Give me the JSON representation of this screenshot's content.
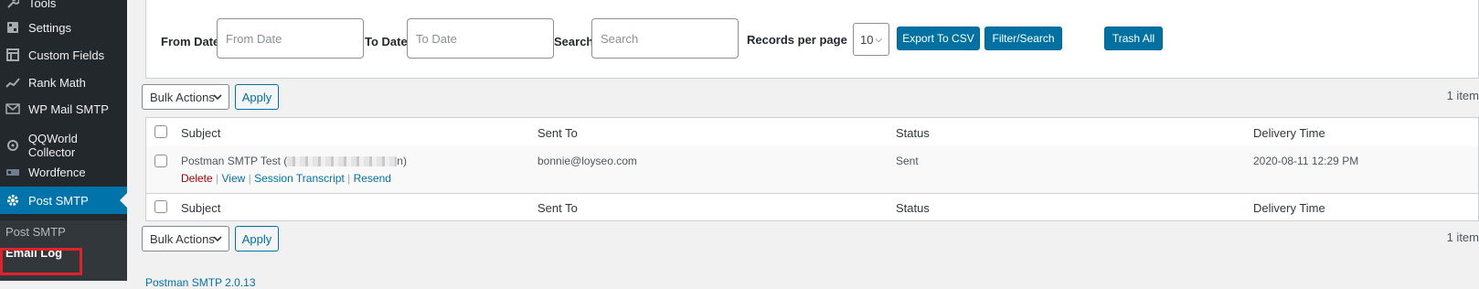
{
  "sidebar": {
    "menu": [
      {
        "label": "Tools",
        "icon": "wrench-icon"
      },
      {
        "label": "Settings",
        "icon": "settings-icon"
      },
      {
        "label": "Custom Fields",
        "icon": "custom-fields-icon"
      },
      {
        "label": "Rank Math",
        "icon": "rank-math-icon"
      },
      {
        "label": "WP Mail SMTP",
        "icon": "mail-icon"
      },
      {
        "label": "QQWorld Collector",
        "icon": "collector-icon"
      },
      {
        "label": "Wordfence",
        "icon": "wordfence-icon"
      },
      {
        "label": "Post SMTP",
        "icon": "gear-icon"
      }
    ],
    "submenu": [
      {
        "label": "Post SMTP"
      },
      {
        "label": "Email Log"
      }
    ],
    "colors": {
      "bg": "#23282d",
      "active": "#0073aa",
      "highlight_box": "#e0222b"
    }
  },
  "filters": {
    "from_date_label": "From Date",
    "from_date_placeholder": "From Date",
    "to_date_label": "To Date",
    "to_date_placeholder": "To Date",
    "search_label": "Search",
    "search_placeholder": "Search",
    "records_label": "Records per page",
    "records_value": "10",
    "export_button": "Export To CSV",
    "filter_button": "Filter/Search",
    "trash_button": "Trash All"
  },
  "bulk": {
    "top_label": "Bulk Actions",
    "top_apply": "Apply",
    "bottom_label": "Bulk Actions",
    "bottom_apply": "Apply",
    "items_count": "1 item"
  },
  "table": {
    "columns": [
      "Subject",
      "Sent To",
      "Status",
      "Delivery Time"
    ],
    "rows": [
      {
        "subject": "Postman SMTP Test (",
        "subject_end": "n)",
        "sent_to": "bonnie@loyseo.com",
        "status": "Sent",
        "delivery_time": "2020-08-11 12:29 PM",
        "actions": [
          "Delete",
          "View",
          "Session Transcript",
          "Resend"
        ]
      }
    ]
  },
  "footer": {
    "text": "Postman SMTP 2.0.13"
  }
}
